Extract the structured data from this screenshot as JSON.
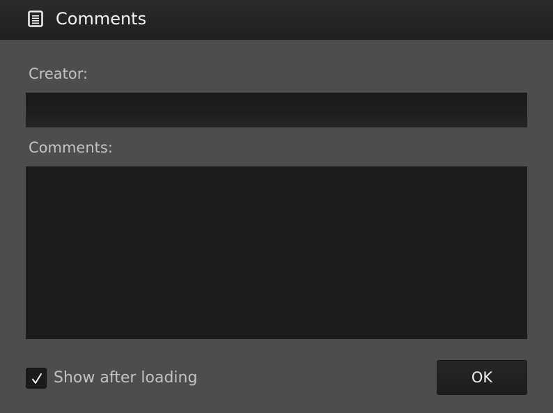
{
  "window": {
    "title": "Comments",
    "title_icon": "document-icon"
  },
  "form": {
    "creator_label": "Creator:",
    "creator_value": "",
    "comments_label": "Comments:",
    "comments_value": ""
  },
  "footer": {
    "show_after_loading_label": "Show after loading",
    "show_after_loading_checked": true,
    "ok_label": "OK"
  },
  "colors": {
    "background": "#4d4d4d",
    "titlebar": "#1f1f1f",
    "field": "#1c1c1c",
    "label_text": "#c2c2c2",
    "title_text": "#f2f2f2"
  }
}
